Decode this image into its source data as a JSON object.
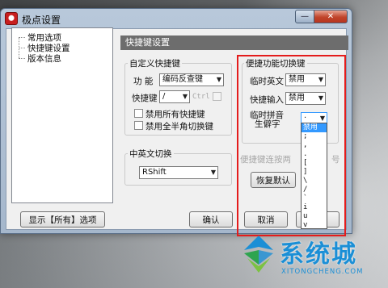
{
  "window": {
    "title": "极点设置",
    "minimize_glyph": "—",
    "close_glyph": "✕"
  },
  "tree": {
    "items": [
      "常用选项",
      "快捷键设置",
      "版本信息"
    ]
  },
  "show_all_button": "显示【所有】选项",
  "panel_title": "快捷键设置",
  "custom_shortcut": {
    "title": "自定义快捷键",
    "function_label": "功  能",
    "function_value": "编码反查键",
    "shortcut_label": "快捷键",
    "shortcut_value": "/",
    "ctrl_label": "Ctrl",
    "disable_all": "禁用所有快捷键",
    "disable_fullhalf": "禁用全半角切换键"
  },
  "cn_en_switch": {
    "title": "中英文切换",
    "value": "RShift"
  },
  "convenient": {
    "title": "便捷功能切换键",
    "temp_english_label": "临时英文",
    "temp_english_value": "禁用",
    "shortcut_input_label": "快捷输入",
    "shortcut_input_value": "禁用",
    "temp_pinyin_label1": "临时拼音",
    "temp_pinyin_label2": "生僻字",
    "temp_pinyin_value": "·",
    "hint_text": "便捷键连按两",
    "hint_tail": "号"
  },
  "dropdown_options": [
    "禁用",
    ";",
    ",",
    ".",
    "[",
    "]",
    "\\",
    "/",
    "`",
    "i",
    "u",
    "v"
  ],
  "buttons": {
    "restore": "恢复默认",
    "ok": "确认",
    "cancel": "取消"
  },
  "watermark": {
    "text": "系统城",
    "sub": "XITONGCHENG.COM"
  },
  "colors": {
    "highlight": "#e41c1c",
    "selection": "#3399ff",
    "watermark": "#1b8fd6"
  }
}
